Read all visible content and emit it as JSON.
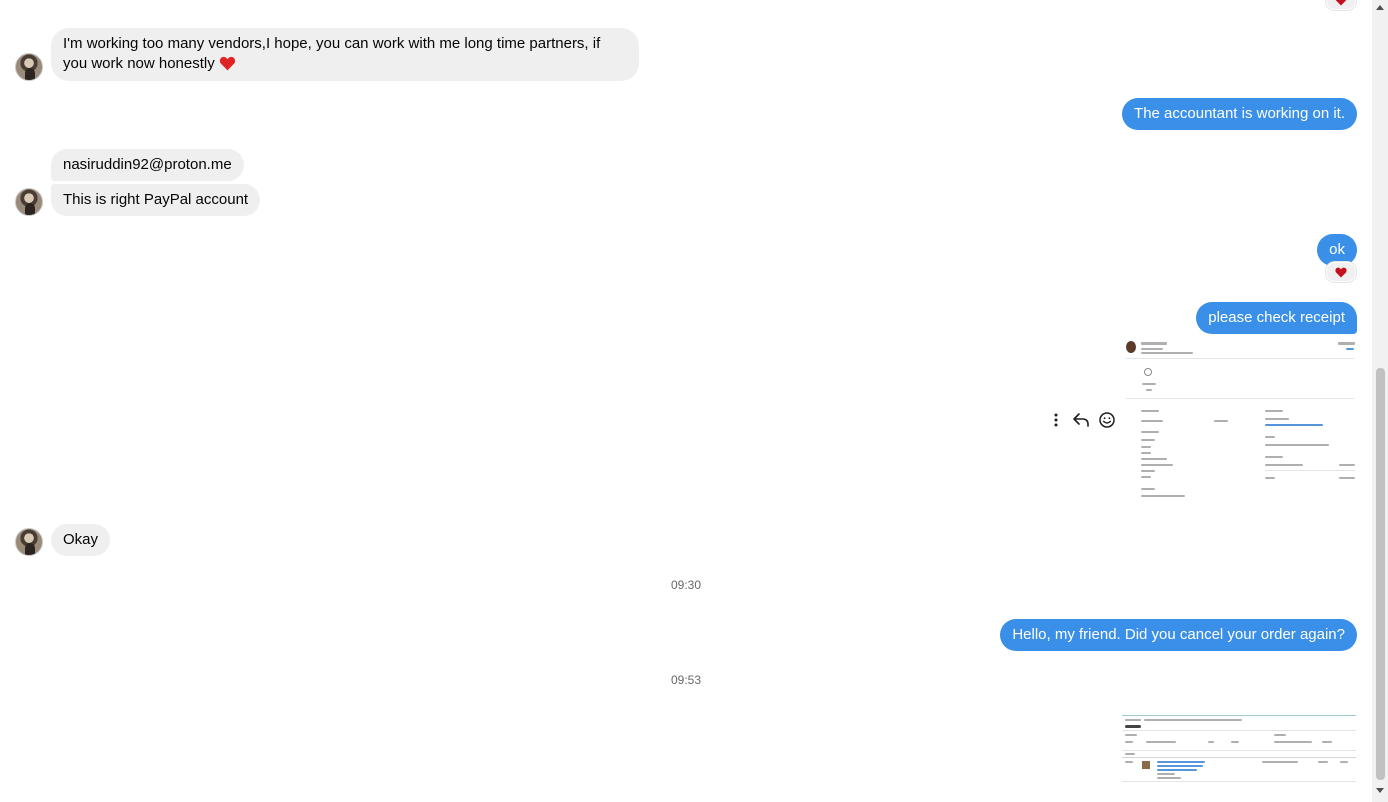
{
  "messages": {
    "in_1": "I'm working too many vendors,I hope, you can work with me long time partners, if you work now honestly",
    "out_1": "The accountant is working on it.",
    "in_2": "nasiruddin92@proton.me",
    "in_3": "This is right PayPal account",
    "out_2": "ok",
    "out_3": "please check receipt",
    "in_4": "Okay",
    "out_4": "Hello, my friend. Did you cancel your order again?"
  },
  "timestamps": {
    "t1": "09:30",
    "t2": "09:53"
  },
  "icons": {
    "reaction": "heart-icon",
    "more": "more-vertical-icon",
    "reply": "reply-icon",
    "react": "smiley-icon"
  },
  "colors": {
    "outgoing_bubble": "#3a8fe8",
    "incoming_bubble": "#efefef",
    "heart": "#e02424"
  }
}
